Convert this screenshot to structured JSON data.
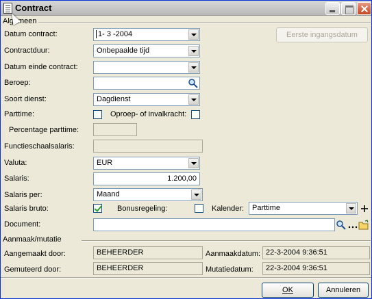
{
  "window": {
    "title": "Contract"
  },
  "algemeen": {
    "group_label": "Algemeen",
    "datum_contract": {
      "label": "Datum contract:",
      "value": "1- 3 -2004"
    },
    "eerste_ingangsdatum_button": "Eerste ingangsdatum",
    "contractduur": {
      "label": "Contractduur:",
      "value": "Onbepaalde tijd"
    },
    "datum_einde_contract": {
      "label": "Datum einde contract:",
      "value": ""
    },
    "beroep": {
      "label": "Beroep:",
      "value": ""
    },
    "soort_dienst": {
      "label": "Soort dienst:",
      "value": "Dagdienst"
    },
    "parttime": {
      "label": "Parttime:",
      "checked": false
    },
    "oproep": {
      "label": "Oproep- of invalkracht:",
      "checked": false
    },
    "percentage_parttime": {
      "label": "Percentage parttime:",
      "value": ""
    },
    "functieschaalsalaris": {
      "label": "Functieschaalsalaris:",
      "value": ""
    },
    "valuta": {
      "label": "Valuta:",
      "value": "EUR"
    },
    "salaris": {
      "label": "Salaris:",
      "value": "1.200,00"
    },
    "salaris_per": {
      "label": "Salaris per:",
      "value": "Maand"
    },
    "salaris_bruto": {
      "label": "Salaris bruto:",
      "checked": true
    },
    "bonusregeling": {
      "label": "Bonusregeling:",
      "checked": false
    },
    "kalender": {
      "label": "Kalender:",
      "value": "Parttime"
    },
    "document": {
      "label": "Document:",
      "value": ""
    }
  },
  "aanmaak": {
    "group_label": "Aanmaak/mutatie",
    "aangemaakt_door": {
      "label": "Aangemaakt door:",
      "value": "BEHEERDER"
    },
    "aanmaakdatum": {
      "label": "Aanmaakdatum:",
      "value": "22-3-2004 9:36:51"
    },
    "gemuteerd_door": {
      "label": "Gemuteerd door:",
      "value": "BEHEERDER"
    },
    "mutatiedatum": {
      "label": "Mutatiedatum:",
      "value": "22-3-2004 9:36:51"
    }
  },
  "buttons": {
    "ok": "OK",
    "annuleren": "Annuleren"
  },
  "icons": {
    "title": "document-icon",
    "search": "magnifier-icon",
    "browse": "ellipsis-icon",
    "open_folder": "folder-icon",
    "add": "plus-icon"
  }
}
